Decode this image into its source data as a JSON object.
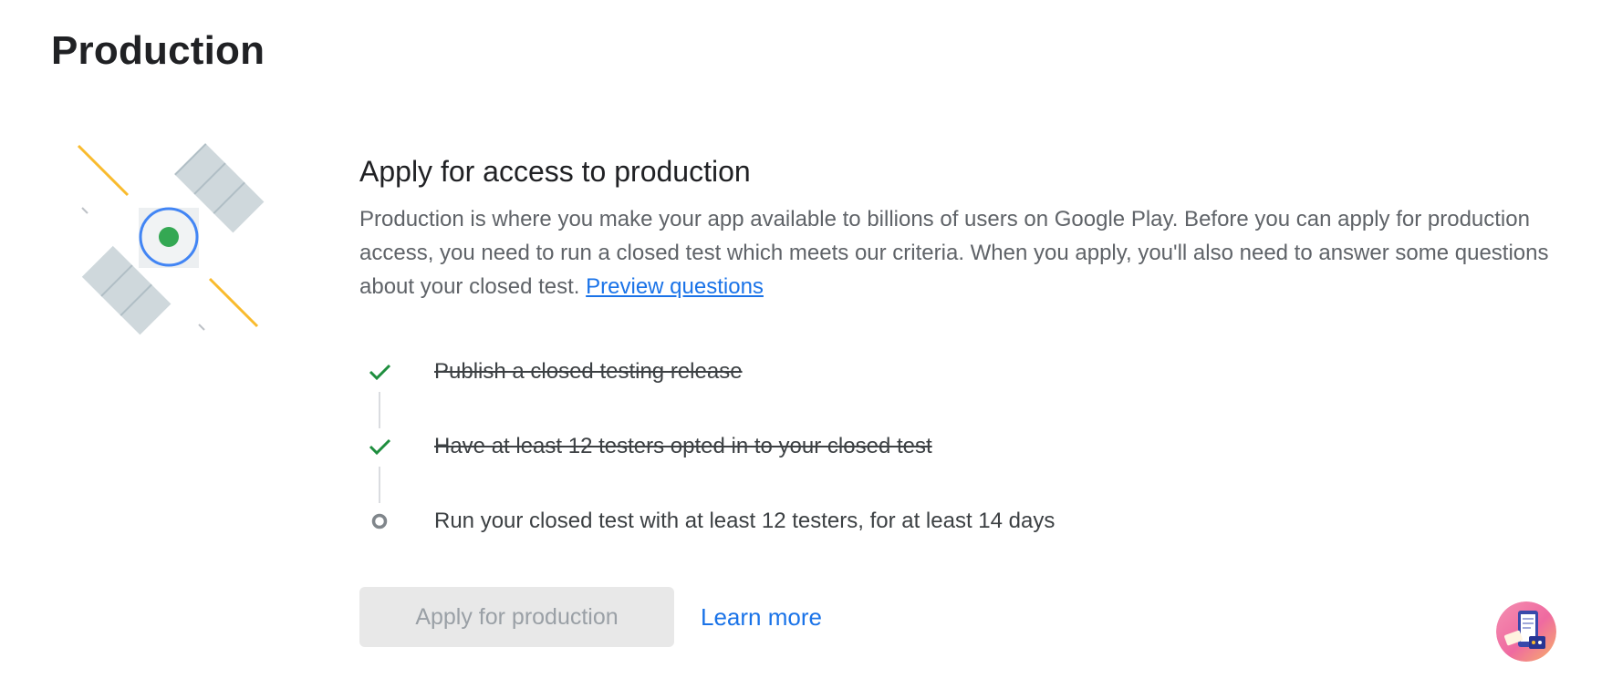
{
  "page": {
    "title": "Production"
  },
  "section": {
    "heading": "Apply for access to production",
    "description": "Production is where you make your app available to billions of users on Google Play. Before you can apply for production access, you need to run a closed test which meets our criteria. When you apply, you'll also need to answer some questions about your closed test. ",
    "preview_link": "Preview questions"
  },
  "checklist": [
    {
      "label": "Publish a closed testing release",
      "status": "completed",
      "icon": "checkmark-icon"
    },
    {
      "label": "Have at least 12 testers opted in to your closed test",
      "status": "completed",
      "icon": "checkmark-icon"
    },
    {
      "label": "Run your closed test with at least 12 testers, for at least 14 days",
      "status": "pending",
      "icon": "pending-circle-icon"
    }
  ],
  "actions": {
    "apply_label": "Apply for production",
    "apply_enabled": false,
    "learn_more_label": "Learn more"
  },
  "icons": {
    "illustration": "satellite-illustration",
    "assistant": "assistant-avatar-icon"
  },
  "colors": {
    "check": "#1e8e3e",
    "link": "#1a73e8",
    "pending": "#80868b",
    "disabled_button_bg": "#e8e8e8",
    "disabled_button_text": "#9aa0a6"
  }
}
